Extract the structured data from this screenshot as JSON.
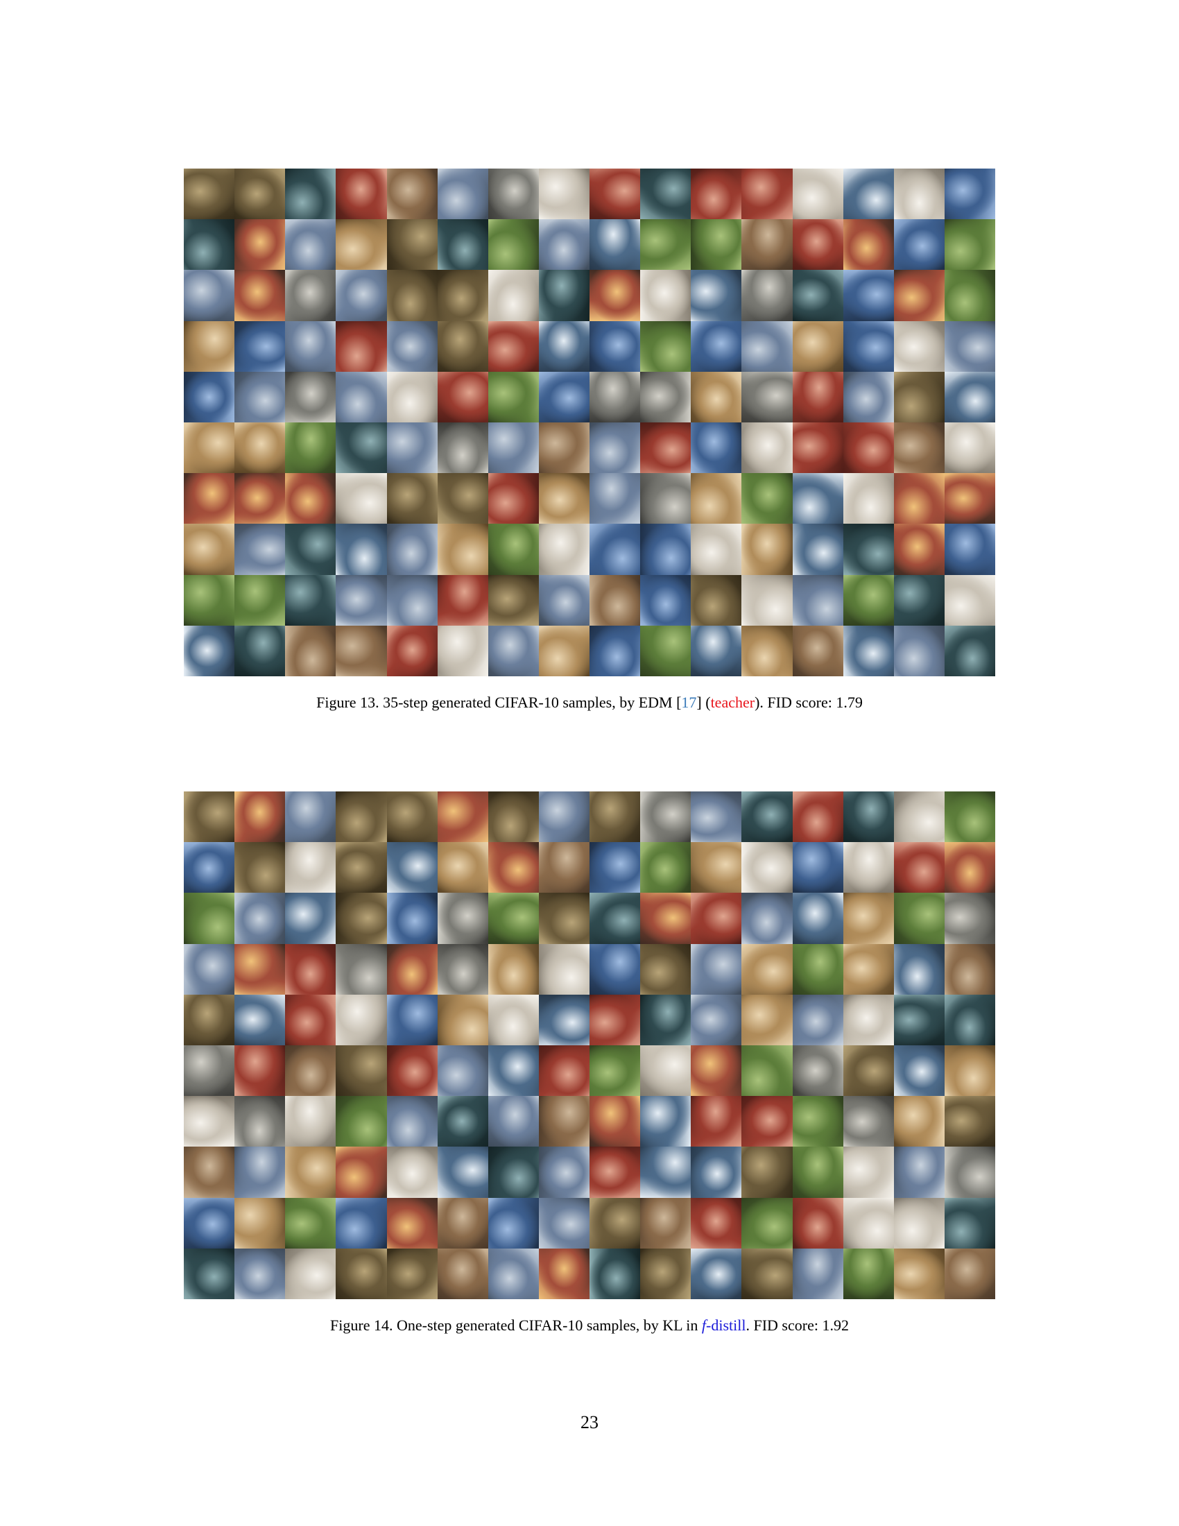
{
  "figure13": {
    "caption": {
      "prefix": "Figure 13. 35-step generated CIFAR-10 samples, by EDM [",
      "cite": "17",
      "mid": "] (",
      "teacher": "teacher",
      "suffix": "). FID score: 1.79"
    },
    "grid": {
      "rows": 10,
      "cols": 16
    }
  },
  "figure14": {
    "caption": {
      "prefix": "Figure 14. One-step generated CIFAR-10 samples, by KL in ",
      "method_f": "f",
      "method_rest": "-distill",
      "suffix": ". FID score: 1.92"
    },
    "grid": {
      "rows": 10,
      "cols": 16
    }
  },
  "page_number": "23",
  "colors": {
    "citation": "#3a7ab8",
    "teacher": "#e8141b",
    "method": "#1a1ad9"
  }
}
